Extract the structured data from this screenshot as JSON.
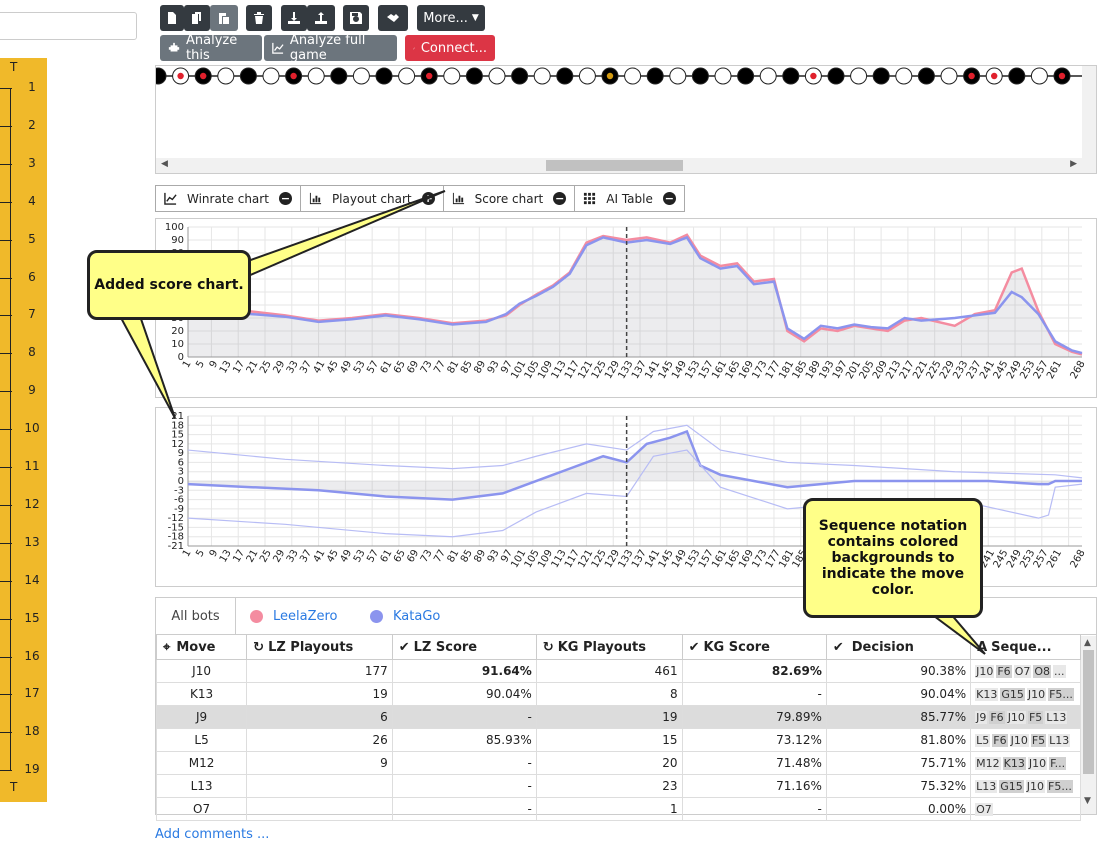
{
  "toolbar": {
    "more_label": "More...",
    "analyze_this_label": "Analyze this",
    "analyze_full_label": "Analyze full game",
    "connect_label": "Connect..."
  },
  "board": {
    "top_letter": "T",
    "bottom_letter": "T",
    "rows": [
      "1",
      "2",
      "3",
      "4",
      "5",
      "6",
      "7",
      "8",
      "9",
      "10",
      "11",
      "12",
      "13",
      "14",
      "15",
      "16",
      "17",
      "18",
      "19"
    ]
  },
  "chart_tabs": [
    {
      "label": "Winrate chart",
      "state": "−"
    },
    {
      "label": "Playout chart",
      "state": "+"
    },
    {
      "label": "Score chart",
      "state": "−"
    },
    {
      "label": "AI Table",
      "state": "−"
    }
  ],
  "callouts": {
    "score": "Added score chart.",
    "sequence": "Sequence notation contains colored backgrounds to indicate the move color."
  },
  "chart_data": [
    {
      "type": "line",
      "title": "",
      "ylim": [
        0,
        100
      ],
      "y_ticks": [
        100,
        90,
        80,
        70,
        60,
        50,
        40,
        30,
        20,
        10,
        0
      ],
      "x_ticks": [
        "1",
        "5",
        "9",
        "13",
        "17",
        "21",
        "25",
        "29",
        "33",
        "37",
        "41",
        "45",
        "49",
        "53",
        "57",
        "61",
        "65",
        "69",
        "73",
        "77",
        "81",
        "85",
        "89",
        "93",
        "97",
        "101",
        "105",
        "109",
        "113",
        "117",
        "121",
        "125",
        "129",
        "133",
        "137",
        "141",
        "145",
        "149",
        "153",
        "157",
        "161",
        "165",
        "169",
        "173",
        "177",
        "181",
        "185",
        "189",
        "193",
        "197",
        "201",
        "205",
        "209",
        "213",
        "217",
        "221",
        "225",
        "229",
        "233",
        "237",
        "241",
        "245",
        "249",
        "253",
        "257",
        "261",
        "268"
      ],
      "marker_x": 132,
      "series": [
        {
          "name": "LeelaZero",
          "color": "#f48ca0",
          "points": [
            [
              1,
              38
            ],
            [
              10,
              36
            ],
            [
              20,
              35
            ],
            [
              30,
              32
            ],
            [
              40,
              28
            ],
            [
              50,
              30
            ],
            [
              60,
              33
            ],
            [
              70,
              30
            ],
            [
              80,
              26
            ],
            [
              90,
              28
            ],
            [
              96,
              32
            ],
            [
              100,
              40
            ],
            [
              105,
              48
            ],
            [
              110,
              55
            ],
            [
              115,
              65
            ],
            [
              120,
              88
            ],
            [
              125,
              93
            ],
            [
              132,
              90
            ],
            [
              138,
              92
            ],
            [
              145,
              88
            ],
            [
              150,
              94
            ],
            [
              154,
              78
            ],
            [
              160,
              70
            ],
            [
              165,
              72
            ],
            [
              170,
              58
            ],
            [
              176,
              60
            ],
            [
              180,
              20
            ],
            [
              185,
              12
            ],
            [
              190,
              22
            ],
            [
              195,
              20
            ],
            [
              200,
              24
            ],
            [
              205,
              22
            ],
            [
              210,
              20
            ],
            [
              215,
              28
            ],
            [
              220,
              30
            ],
            [
              230,
              24
            ],
            [
              236,
              33
            ],
            [
              242,
              36
            ],
            [
              247,
              65
            ],
            [
              250,
              68
            ],
            [
              255,
              35
            ],
            [
              260,
              10
            ],
            [
              265,
              4
            ],
            [
              268,
              2
            ]
          ]
        },
        {
          "name": "KataGo",
          "color": "#8b94ee",
          "points": [
            [
              1,
              37
            ],
            [
              10,
              35
            ],
            [
              20,
              33
            ],
            [
              30,
              31
            ],
            [
              40,
              27
            ],
            [
              50,
              29
            ],
            [
              60,
              32
            ],
            [
              70,
              29
            ],
            [
              80,
              25
            ],
            [
              90,
              27
            ],
            [
              96,
              33
            ],
            [
              100,
              41
            ],
            [
              105,
              47
            ],
            [
              110,
              54
            ],
            [
              115,
              64
            ],
            [
              120,
              86
            ],
            [
              125,
              92
            ],
            [
              132,
              88
            ],
            [
              138,
              90
            ],
            [
              145,
              87
            ],
            [
              150,
              92
            ],
            [
              154,
              76
            ],
            [
              160,
              68
            ],
            [
              165,
              70
            ],
            [
              170,
              56
            ],
            [
              176,
              58
            ],
            [
              180,
              22
            ],
            [
              185,
              14
            ],
            [
              190,
              24
            ],
            [
              195,
              22
            ],
            [
              200,
              25
            ],
            [
              205,
              23
            ],
            [
              210,
              22
            ],
            [
              215,
              30
            ],
            [
              220,
              28
            ],
            [
              230,
              30
            ],
            [
              236,
              32
            ],
            [
              242,
              34
            ],
            [
              247,
              50
            ],
            [
              250,
              46
            ],
            [
              255,
              33
            ],
            [
              260,
              12
            ],
            [
              265,
              5
            ],
            [
              268,
              3
            ]
          ]
        }
      ]
    },
    {
      "type": "line",
      "title": "",
      "ylim": [
        -21,
        21
      ],
      "y_ticks": [
        21,
        18,
        15,
        12,
        9,
        6,
        3,
        0,
        -3,
        -6,
        -9,
        -12,
        -15,
        -18,
        -21
      ],
      "x_ticks": [
        "1",
        "5",
        "9",
        "13",
        "17",
        "21",
        "25",
        "29",
        "33",
        "37",
        "41",
        "45",
        "49",
        "53",
        "57",
        "61",
        "65",
        "69",
        "73",
        "77",
        "81",
        "85",
        "89",
        "93",
        "97",
        "101",
        "105",
        "109",
        "113",
        "117",
        "121",
        "125",
        "129",
        "133",
        "137",
        "141",
        "145",
        "149",
        "153",
        "157",
        "161",
        "165",
        "169",
        "173",
        "177",
        "181",
        "185",
        "189",
        "193",
        "197",
        "201",
        "205",
        "209",
        "213",
        "217",
        "221",
        "225",
        "229",
        "233",
        "237",
        "241",
        "245",
        "249",
        "253",
        "257",
        "261",
        "268"
      ],
      "marker_x": 132,
      "series": [
        {
          "name": "KataGo",
          "color": "#8b94ee",
          "points": [
            [
              1,
              -1
            ],
            [
              20,
              -2
            ],
            [
              40,
              -3
            ],
            [
              60,
              -5
            ],
            [
              80,
              -6
            ],
            [
              95,
              -4
            ],
            [
              100,
              -2
            ],
            [
              110,
              2
            ],
            [
              115,
              4
            ],
            [
              120,
              6
            ],
            [
              125,
              8
            ],
            [
              132,
              6
            ],
            [
              138,
              12
            ],
            [
              145,
              14
            ],
            [
              150,
              16
            ],
            [
              154,
              5
            ],
            [
              160,
              2
            ],
            [
              170,
              0
            ],
            [
              180,
              -2
            ],
            [
              190,
              -1
            ],
            [
              200,
              0
            ],
            [
              220,
              0
            ],
            [
              240,
              0
            ],
            [
              255,
              -1
            ],
            [
              258,
              -1
            ],
            [
              260,
              0
            ],
            [
              268,
              0
            ]
          ]
        },
        {
          "name": "KataGo",
          "color": "#b7bcf5",
          "points": [
            [
              1,
              10
            ],
            [
              30,
              7
            ],
            [
              60,
              5
            ],
            [
              80,
              4
            ],
            [
              95,
              5
            ],
            [
              105,
              8
            ],
            [
              120,
              12
            ],
            [
              132,
              10
            ],
            [
              140,
              16
            ],
            [
              150,
              18
            ],
            [
              160,
              10
            ],
            [
              180,
              6
            ],
            [
              200,
              5
            ],
            [
              230,
              3
            ],
            [
              260,
              2
            ],
            [
              268,
              1
            ]
          ]
        },
        {
          "name": "KataGo",
          "color": "#b7bcf5",
          "points": [
            [
              1,
              -12
            ],
            [
              30,
              -14
            ],
            [
              60,
              -17
            ],
            [
              80,
              -18
            ],
            [
              95,
              -16
            ],
            [
              105,
              -10
            ],
            [
              120,
              -4
            ],
            [
              132,
              -5
            ],
            [
              140,
              8
            ],
            [
              150,
              10
            ],
            [
              160,
              -2
            ],
            [
              180,
              -9
            ],
            [
              200,
              -7
            ],
            [
              230,
              -6
            ],
            [
              255,
              -12
            ],
            [
              258,
              -11
            ],
            [
              260,
              -2
            ],
            [
              268,
              -1
            ]
          ]
        }
      ]
    }
  ],
  "ai_table": {
    "tabs": [
      {
        "label": "All bots",
        "dot": ""
      },
      {
        "label": "LeelaZero",
        "dot": "#f48ca0"
      },
      {
        "label": "KataGo",
        "dot": "#8b94ee"
      }
    ],
    "headers": [
      "Move",
      "LZ Playouts",
      "LZ Score",
      "KG Playouts",
      "KG Score",
      "Decision",
      "Seque..."
    ],
    "rows": [
      {
        "move": "J10",
        "lzp": "177",
        "lzs": "91.64%",
        "kgp": "461",
        "kgs": "82.69%",
        "dec": "90.38%",
        "seq": "J10 F6 O7 O8 ..."
      },
      {
        "move": "K13",
        "lzp": "19",
        "lzs": "90.04%",
        "kgp": "8",
        "kgs": "-",
        "dec": "90.04%",
        "seq": "K13 G15 J10 F5..."
      },
      {
        "move": "J9",
        "lzp": "6",
        "lzs": "-",
        "kgp": "19",
        "kgs": "79.89%",
        "dec": "85.77%",
        "seq": "J9 F6 J10 F5 L13"
      },
      {
        "move": "L5",
        "lzp": "26",
        "lzs": "85.93%",
        "kgp": "15",
        "kgs": "73.12%",
        "dec": "81.80%",
        "seq": "L5 F6 J10 F5 L13"
      },
      {
        "move": "M12",
        "lzp": "9",
        "lzs": "-",
        "kgp": "20",
        "kgs": "71.48%",
        "dec": "75.71%",
        "seq": "M12 K13 J10 F..."
      },
      {
        "move": "L13",
        "lzp": "",
        "lzs": "-",
        "kgp": "23",
        "kgs": "71.16%",
        "dec": "75.32%",
        "seq": "L13 G15 J10 F5..."
      },
      {
        "move": "O7",
        "lzp": "",
        "lzs": "-",
        "kgp": "1",
        "kgs": "-",
        "dec": "0.00%",
        "seq": "O7"
      }
    ]
  },
  "add_comments_label": "Add comments ..."
}
